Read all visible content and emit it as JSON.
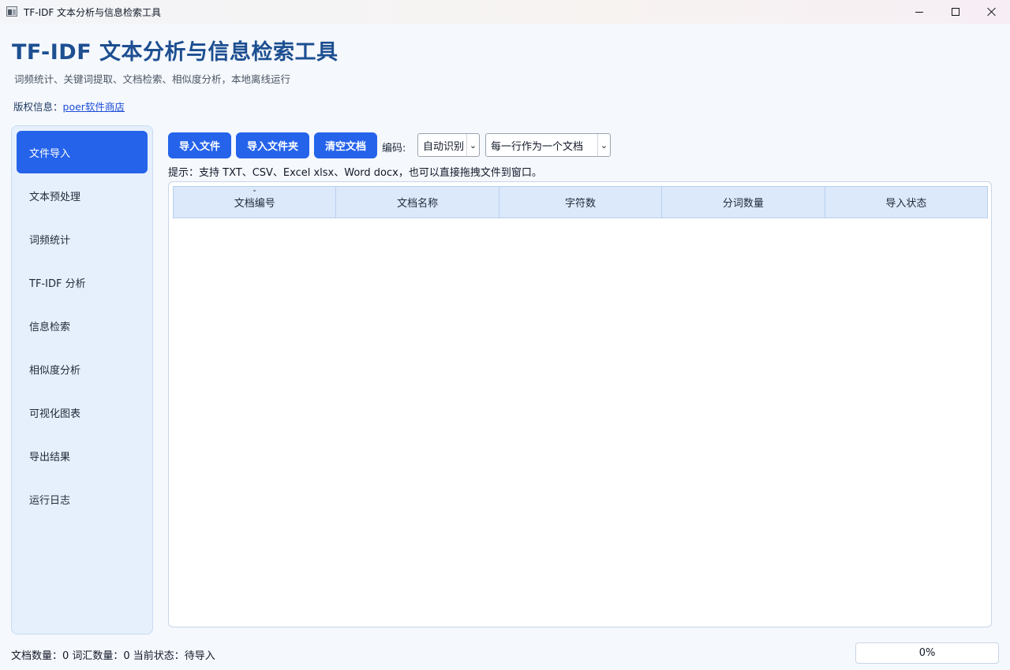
{
  "window": {
    "title": "TF-IDF 文本分析与信息检索工具"
  },
  "header": {
    "title": "TF-IDF 文本分析与信息检索工具",
    "subtitle": "词频统计、关键词提取、文档检索、相似度分析，本地离线运行",
    "copyright_label": "版权信息：",
    "copyright_link": "poer软件商店"
  },
  "sidebar": {
    "items": [
      {
        "label": "文件导入",
        "active": true
      },
      {
        "label": "文本预处理",
        "active": false
      },
      {
        "label": "词频统计",
        "active": false
      },
      {
        "label": "TF-IDF 分析",
        "active": false
      },
      {
        "label": "信息检索",
        "active": false
      },
      {
        "label": "相似度分析",
        "active": false
      },
      {
        "label": "可视化图表",
        "active": false
      },
      {
        "label": "导出结果",
        "active": false
      },
      {
        "label": "运行日志",
        "active": false
      }
    ]
  },
  "toolbar": {
    "import_file": "导入文件",
    "import_folder": "导入文件夹",
    "clear_docs": "清空文档",
    "encoding_label": "编码:",
    "encoding_value": "自动识别",
    "mode_value": "每一行作为一个文档",
    "hint": "提示：支持 TXT、CSV、Excel xlsx、Word docx，也可以直接拖拽文件到窗口。"
  },
  "table": {
    "columns": [
      "文档编号",
      "文档名称",
      "字符数",
      "分词数量",
      "导入状态"
    ],
    "rows": []
  },
  "status": {
    "text": "文档数量：0   词汇数量：0   当前状态：待导入",
    "progress": "0%"
  },
  "colors": {
    "accent": "#2563eb",
    "heading": "#1d4f91",
    "sidebar_bg": "#e6f0fc",
    "table_header_bg": "#dce9fb"
  }
}
